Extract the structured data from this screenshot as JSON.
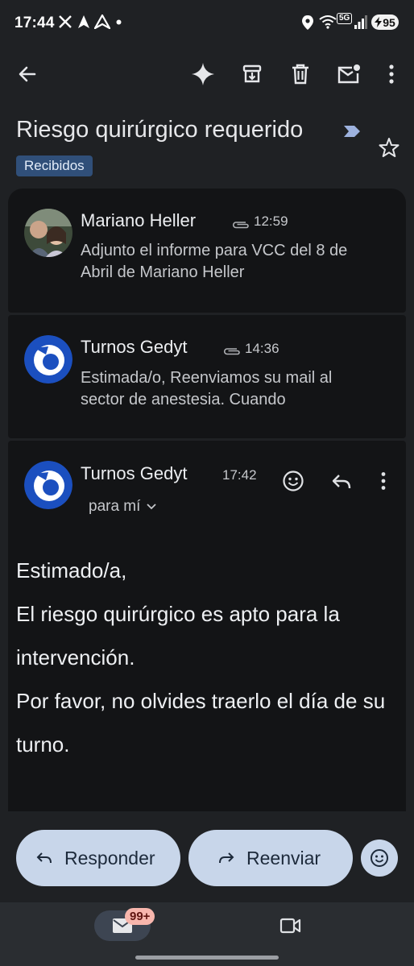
{
  "status_bar": {
    "time": "17:44",
    "battery": "95",
    "network": "5G",
    "icons": [
      "x-logo-icon",
      "arrow-icon",
      "arrow-icon",
      "dot-icon",
      "location-icon",
      "wifi-icon",
      "5g-icon",
      "signal-icon",
      "battery-icon"
    ]
  },
  "toolbar": {
    "icons": [
      "back-arrow-icon",
      "gemini-sparkle-icon",
      "archive-icon",
      "delete-icon",
      "mark-unread-icon",
      "more-vert-icon"
    ]
  },
  "thread": {
    "subject": "Riesgo quirúrgico requerido",
    "label": "Recibidos",
    "messages": [
      {
        "sender": "Mariano Heller",
        "time": "12:59",
        "has_attachment": true,
        "snippet": "Adjunto el informe para VCC del 8 de Abril de Mariano Heller"
      },
      {
        "sender": "Turnos Gedyt",
        "time": "14:36",
        "has_attachment": true,
        "snippet": "Estimada/o, Reenviamos su mail al sector de anestesia. Cuando"
      },
      {
        "sender": "Turnos Gedyt",
        "time": "17:42",
        "recipient": "para mí",
        "body": [
          "Estimado/a,",
          "El riesgo quirúrgico es apto para la intervención.",
          "Por favor, no olvides traerlo el día de su turno."
        ]
      }
    ]
  },
  "actions": {
    "reply": "Responder",
    "forward": "Reenviar"
  },
  "bottom_nav": {
    "mail_badge": "99+"
  },
  "colors": {
    "background": "#1f2124",
    "card": "#131416",
    "label_bg": "#304f79",
    "button_bg": "#c8d6ea",
    "badge_bg": "#f8b6ad",
    "gedyt_blue": "#1b4fbf"
  }
}
